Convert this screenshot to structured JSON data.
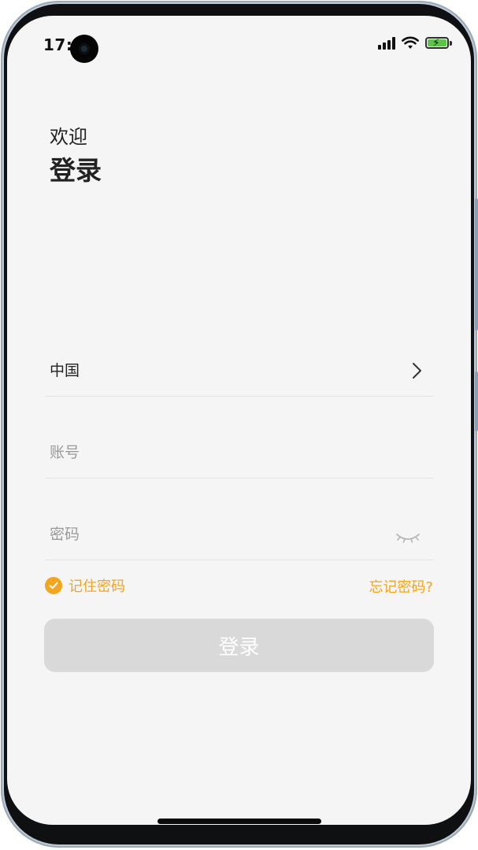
{
  "status_bar": {
    "time": "17:1",
    "icons": [
      "signal-icon",
      "wifi-icon",
      "battery-charging-icon"
    ],
    "battery_color": "#5ec34a"
  },
  "header": {
    "welcome": "欢迎",
    "title": "登录"
  },
  "form": {
    "country": {
      "value": "中国",
      "icon": "chevron-right-icon"
    },
    "account": {
      "placeholder": "账号"
    },
    "password": {
      "placeholder": "密码",
      "icon": "eye-closed-icon"
    },
    "remember": {
      "label": "记住密码",
      "checked": true
    },
    "forgot_label": "忘记密码?",
    "login_label": "登录"
  },
  "colors": {
    "accent": "#f2a51d",
    "background": "#f5f5f5",
    "button_disabled": "#d9d9d9",
    "text": "#222222",
    "placeholder": "#9a9a9a"
  }
}
